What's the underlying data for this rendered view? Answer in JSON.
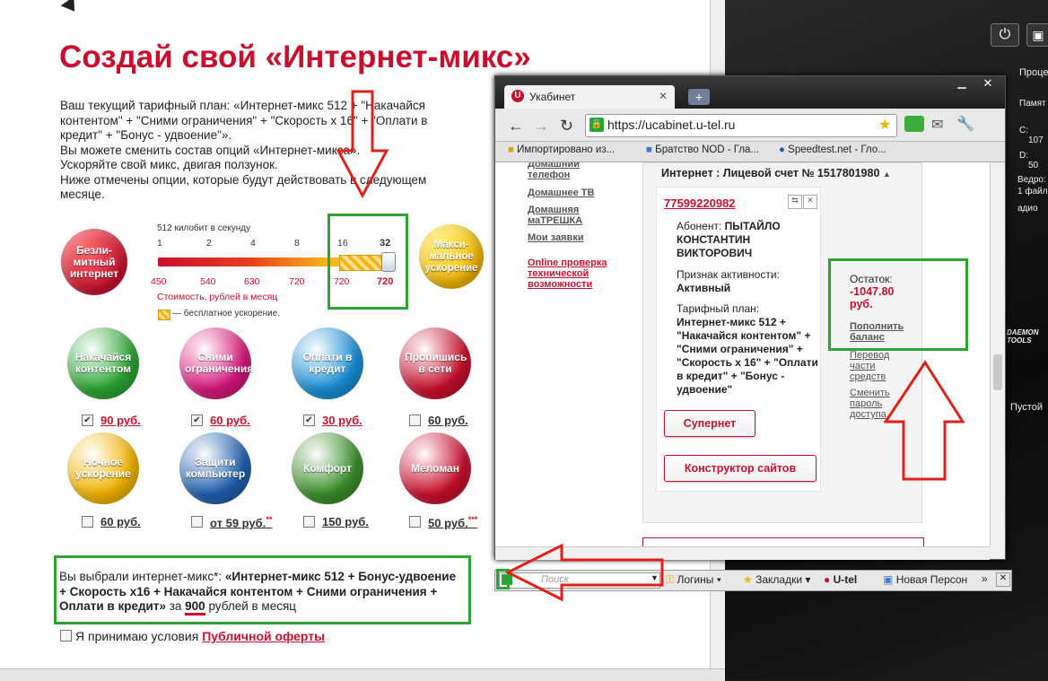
{
  "page": {
    "title": "Создай свой «Интернет-микс»",
    "intro": "Ваш текущий тарифный план: «Интернет-микс 512 + \"Накачайся контентом\" + \"Сними ограничения\" + \"Скорость х 16\" + \"Оплати в кредит\" + \"Бонус - удвоение\"».\nВы можете сменить состав опций «Интернет-микса».\nУскоряйте свой микс, двигая ползунок.\nНиже отмечены опции, которые будут действовать в следующем месяце.",
    "badge_left": "Безли-митный интернет",
    "badge_right": "Макси-мальное ускорение",
    "slider": {
      "label": "512 килобит в секунду",
      "speeds": [
        "1",
        "2",
        "4",
        "8",
        "16",
        "32"
      ],
      "prices": [
        "450",
        "540",
        "630",
        "720",
        "720",
        "720"
      ],
      "cost_caption": "Стоимость, рублей в месяц",
      "legend": "— бесплатное ускорение.",
      "value_fraction": 0.97
    },
    "options": [
      {
        "label": "Накачайся контентом",
        "price": "90 руб.",
        "checked": true,
        "color": "#2aa531"
      },
      {
        "label": "Сними ограничения",
        "price": "60 руб.",
        "checked": true,
        "color": "#d6177a"
      },
      {
        "label": "Оплати в кредит",
        "price": "30 руб.",
        "checked": true,
        "color": "#1a8fd6"
      },
      {
        "label": "Пропишись в сети",
        "price": "60 руб.",
        "checked": false,
        "color": "#c8102e"
      },
      {
        "label": "Ночное ускорение",
        "price": "60 руб.",
        "checked": false,
        "color": "#f4b400"
      },
      {
        "label": "Защити компьютер",
        "price": "от 59 руб.",
        "mark": "**",
        "checked": false,
        "color": "#1f5fae"
      },
      {
        "label": "Комфорт",
        "price": "150 руб.",
        "checked": false,
        "color": "#3b8f2a"
      },
      {
        "label": "Меломан",
        "price": "50 руб.",
        "mark": "***",
        "checked": false,
        "color": "#c8102e"
      }
    ],
    "summary_prefix": "Вы выбрали интернет-микс*: ",
    "summary_bold": "«Интернет-микс 512 + Бонус-удвоение + Скорость х16 + Накачайся контентом + Сними ограничения + Оплати в кредит»",
    "summary_za": " за ",
    "summary_price": "900",
    "summary_suffix": " рублей в месяц",
    "accept_text": "Я принимаю условия ",
    "accept_link": "Публичной оферты"
  },
  "browser": {
    "tab_title": "Укабинет",
    "new_tab": "+",
    "url": "https://ucabinet.u-tel.ru",
    "bookmarks": [
      "Импортировано из...",
      "Братство NOD - Гла...",
      "Speedtest.net - Гло..."
    ],
    "sidebar": [
      "Домашний телефон",
      "Домашнее ТВ",
      "Домашняя маТРЕШКА",
      "Мои заявки"
    ],
    "sidebar_red": "Online проверка технической возможности",
    "account_header": "Интернет : Лицевой счет № 1517801980",
    "phone": "77599220982",
    "subscriber_label": "Абонент: ",
    "subscriber_name": "ПЫТАЙЛО КОНСТАНТИН ВИКТОРОВИЧ",
    "activity_label": "Признак активности:",
    "activity_value": "Активный",
    "plan_label": "Тарифный план:",
    "plan_value": "Интернет-микс 512 + \"Накачайся контентом\" + \"Сними ограничения\" + \"Скорость х 16\" + \"Оплати в кредит\" + \"Бонус - удвоение\"",
    "btn_supernet": "Супернет",
    "btn_constructor": "Конструктор сайтов",
    "balance_label": "Остаток:",
    "balance_value": "-1047.80 руб.",
    "topup": "Пополнить баланс",
    "transfer": "Перевод части средств",
    "change_pass": "Сменить пароль доступа"
  },
  "toolbar2": {
    "search_placeholder": "Поиск",
    "logins": "Логины",
    "bookmarks": "Закладки",
    "utel": "U-tel",
    "newpers": "Новая Персон"
  },
  "desktop": {
    "process": "Проце",
    "memory": "Памят",
    "c_drive": "C:",
    "c_val": "107",
    "d_drive": "D:",
    "d_val": "50",
    "bucket": "Ведро:",
    "onefile": "1 файл",
    "audio": "адио",
    "daemon": "DAEMON TOOLS",
    "empty": "Пустой"
  },
  "colors": {
    "brand_red": "#c8102e",
    "green_box": "#2aa531",
    "arrow_red": "#e2201a"
  }
}
